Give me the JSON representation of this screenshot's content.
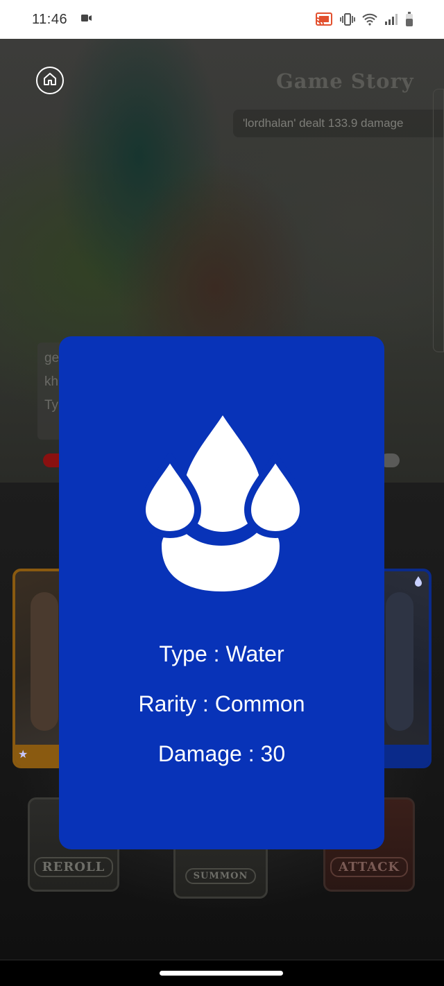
{
  "status_bar": {
    "time": "11:46",
    "icons": [
      "video-record-icon",
      "cast-icon",
      "vibrate-icon",
      "wifi-icon",
      "signal-icon",
      "battery-icon"
    ]
  },
  "game": {
    "story_title": "Game Story",
    "story_lines": [
      "'lordhalan' dealt 133.9 damage"
    ],
    "side_text": [
      "ge",
      "kh",
      "Ty"
    ],
    "buttons": {
      "reroll": "REROLL",
      "summon": "SUMMON",
      "attack": "ATTACK"
    }
  },
  "card_modal": {
    "element_icon": "water-drops-icon",
    "type_line": "Type : Water",
    "rarity_line": "Rarity : Common",
    "damage_line": "Damage : 30",
    "colors": {
      "background": "#0833b8",
      "text": "#ffffff"
    }
  }
}
